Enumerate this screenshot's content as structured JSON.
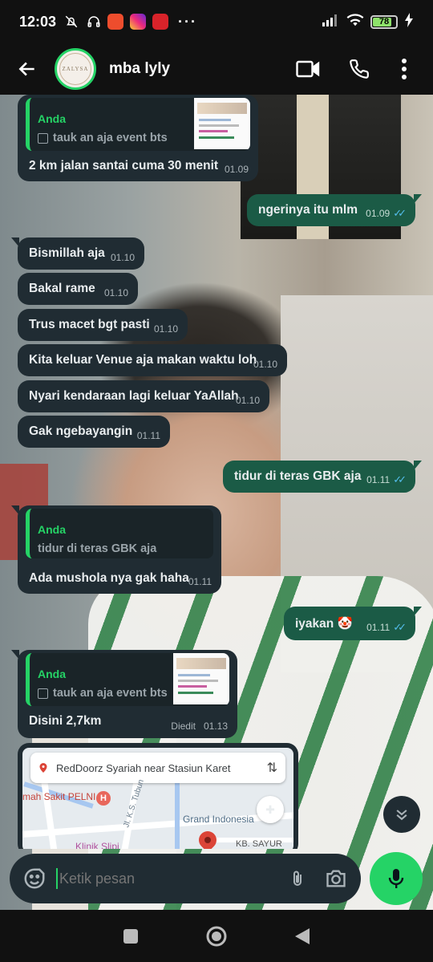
{
  "status_bar": {
    "time": "12:03",
    "battery": "78",
    "battery_level": 0.78,
    "icons": [
      "mute-icon",
      "headphones-icon",
      "shopee-app-icon",
      "instagram-app-icon",
      "news-app-icon",
      "more-dots-icon",
      "signal-icon",
      "wifi-icon",
      "battery-icon",
      "charging-icon"
    ],
    "more_dots": "···"
  },
  "header": {
    "contact_name": "mba lyly",
    "avatar_text": "ZALYSA",
    "icons": [
      "back-arrow-icon",
      "video-call-icon",
      "voice-call-icon",
      "more-vert-icon"
    ]
  },
  "messages": [
    {
      "id": "m1",
      "direction": "in",
      "quote_author": "Anda",
      "quote_text": "tauk an aja event bts",
      "text": "2 km jalan santai cuma 30 menit",
      "time": "01.09"
    },
    {
      "id": "m2",
      "direction": "out",
      "text": "ngerinya itu mlm",
      "time": "01.09",
      "ticks": "✓✓"
    },
    {
      "id": "m3",
      "direction": "in",
      "text": "Bismillah aja",
      "time": "01.10"
    },
    {
      "id": "m4",
      "direction": "in",
      "text": "Bakal rame",
      "time": "01.10"
    },
    {
      "id": "m5",
      "direction": "in",
      "text": "Trus macet bgt pasti",
      "time": "01.10"
    },
    {
      "id": "m6",
      "direction": "in",
      "text": "Kita keluar Venue aja makan waktu loh",
      "time": "01.10"
    },
    {
      "id": "m7",
      "direction": "in",
      "text": "Nyari kendaraan lagi keluar YaAllah",
      "time": "01.10"
    },
    {
      "id": "m8",
      "direction": "in",
      "text": "Gak ngebayangin",
      "time": "01.11"
    },
    {
      "id": "m9",
      "direction": "out",
      "text": "tidur di teras GBK aja",
      "time": "01.11",
      "ticks": "✓✓"
    },
    {
      "id": "m10",
      "direction": "in",
      "quote_author": "Anda",
      "quote_text": "tidur di teras GBK aja",
      "text": "Ada mushola nya gak haha",
      "time": "01.11"
    },
    {
      "id": "m11",
      "direction": "out",
      "text": "iyakan 🤡",
      "time": "01.11",
      "ticks": "✓✓"
    },
    {
      "id": "m12",
      "direction": "in",
      "quote_author": "Anda",
      "quote_text": "tauk an aja event bts",
      "text": "Disini 2,7km",
      "edited": "Diedit",
      "time": "01.13"
    }
  ],
  "map_card": {
    "search_text": "RedDoorz Syariah near Stasiun Karet",
    "labels": {
      "hospital": "mah Sakit PELNI",
      "hospital_marker": "H",
      "street": "Jl. K.S. Tubun",
      "mall": "Grand Indonesia",
      "clinic": "Klinik Slipi",
      "area": "KB. SAYUR"
    }
  },
  "input": {
    "placeholder": "Ketik pesan"
  },
  "nav": {
    "icons": [
      "recents-square-icon",
      "home-circle-icon",
      "back-triangle-icon"
    ]
  },
  "colors": {
    "accent": "#25d366",
    "incoming_bubble": "#202c33",
    "outgoing_bubble": "#1b5b46",
    "read_ticks": "#53bdeb"
  }
}
